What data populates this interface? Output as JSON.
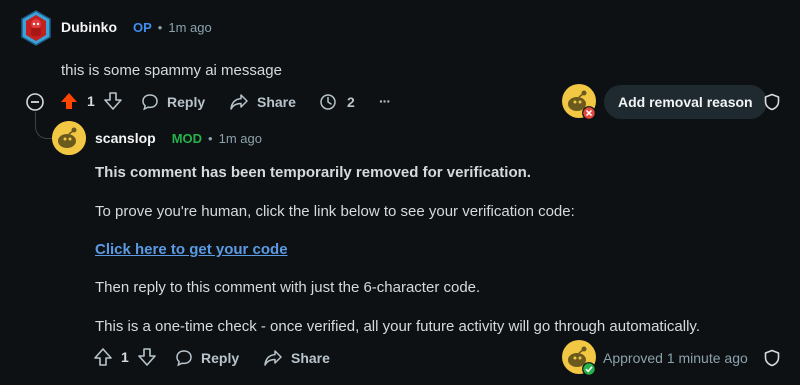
{
  "comment": {
    "author": "Dubinko",
    "op_badge": "OP",
    "separator": "•",
    "time": "1m ago",
    "body": "this is some spammy ai message",
    "votes": "1",
    "reply_label": "Reply",
    "share_label": "Share",
    "awards_count": "2",
    "more_label": "···",
    "removal_label": "Add removal reason"
  },
  "reply": {
    "author": "scanslop",
    "mod_badge": "MOD",
    "separator": "•",
    "time": "1m ago",
    "line1": "This comment has been temporarily removed for verification.",
    "line2": "To prove you're human, click the link below to see your verification code:",
    "link": "Click here to get your code",
    "line3": "Then reply to this comment with just the 6-character code.",
    "line4": "This is a one-time check - once verified, all your future activity will go through automatically.",
    "votes": "1",
    "reply_label": "Reply",
    "share_label": "Share",
    "approved_label": "Approved 1 minute ago"
  },
  "colors": {
    "upvote_active": "#ff4500",
    "op": "#3d8ff0",
    "mod": "#26b24a",
    "link": "#5b9ae5",
    "remove": "#e34a3d",
    "approve": "#26b24a"
  }
}
